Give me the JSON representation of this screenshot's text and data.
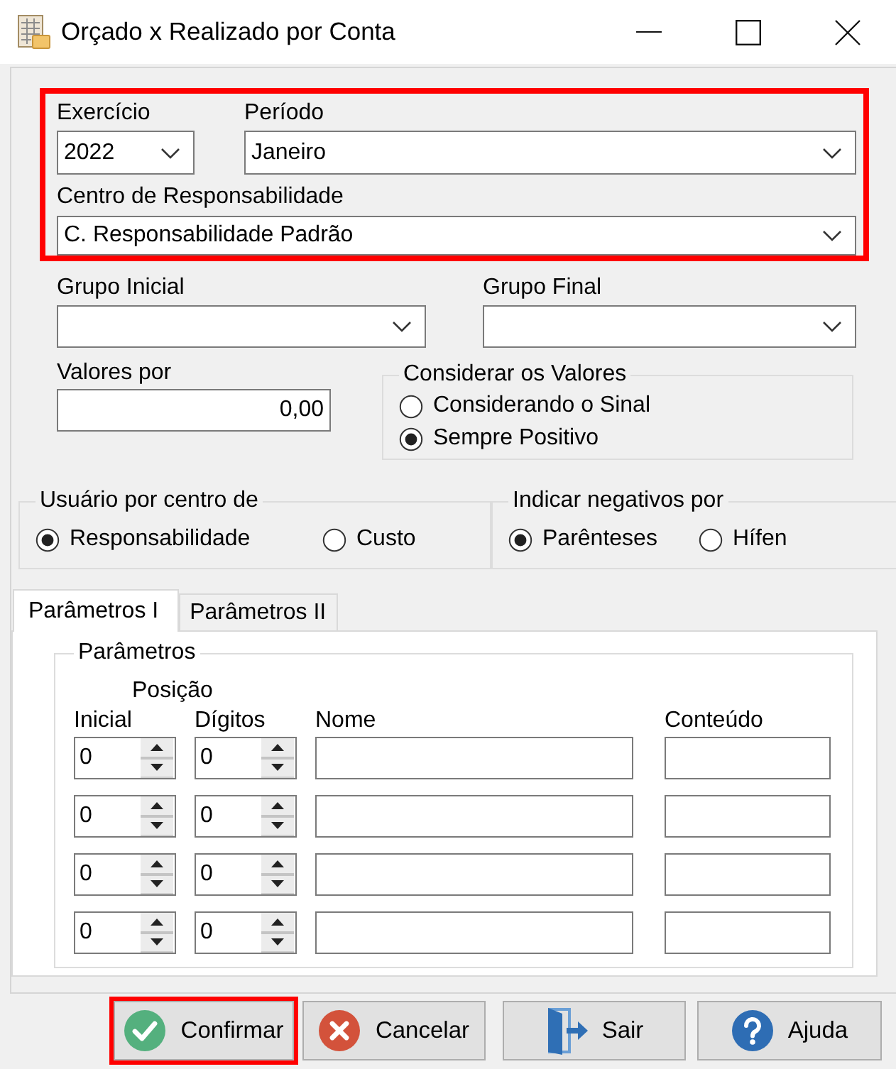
{
  "window": {
    "title": "Orçado x Realizado por Conta"
  },
  "main_filters": {
    "highlighted": true,
    "year": {
      "label": "Exercício",
      "value": "2022"
    },
    "period": {
      "label": "Período",
      "value": "Janeiro"
    },
    "responsibility_center": {
      "label": "Centro de Responsabilidade",
      "value": "C. Responsabilidade Padrão"
    }
  },
  "group_range": {
    "initial_group": {
      "label": "Grupo Inicial"
    },
    "final_group": {
      "label": "Grupo Final"
    }
  },
  "values_by": {
    "label": "Valores por",
    "value": "0,00"
  },
  "consider_values": {
    "title": "Considerar os Valores",
    "options": [
      {
        "label": "Considerando o Sinal",
        "selected": false
      },
      {
        "label": "Sempre Positivo",
        "selected": true
      }
    ]
  },
  "user_by_center": {
    "title": "Usuário por centro de",
    "options": [
      {
        "label": "Responsabilidade",
        "selected": true
      },
      {
        "label": "Custo",
        "selected": false
      }
    ]
  },
  "negatives_by": {
    "title": "Indicar negativos por",
    "options": [
      {
        "label": "Parênteses",
        "selected": true
      },
      {
        "label": "Hífen",
        "selected": false
      }
    ]
  },
  "tabs": [
    {
      "label": "Parâmetros I",
      "selected": true
    },
    {
      "label": "Parâmetros II",
      "selected": false
    }
  ],
  "parameters": {
    "title": "Parâmetros",
    "position_header": "Posição",
    "columns": [
      "Inicial",
      "Dígitos",
      "Nome",
      "Conteúdo"
    ],
    "rows": [
      {
        "initial": "0",
        "digits": "0"
      },
      {
        "initial": "0",
        "digits": "0"
      },
      {
        "initial": "0",
        "digits": "0"
      },
      {
        "initial": "0",
        "digits": "0"
      }
    ]
  },
  "buttons": [
    {
      "kind": "confirm",
      "label": "Confirmar",
      "highlighted": true
    },
    {
      "kind": "cancel",
      "label": "Cancelar",
      "highlighted": false
    },
    {
      "kind": "exit",
      "label": "Sair",
      "highlighted": false
    },
    {
      "kind": "help",
      "label": "Ajuda",
      "highlighted": false
    }
  ]
}
